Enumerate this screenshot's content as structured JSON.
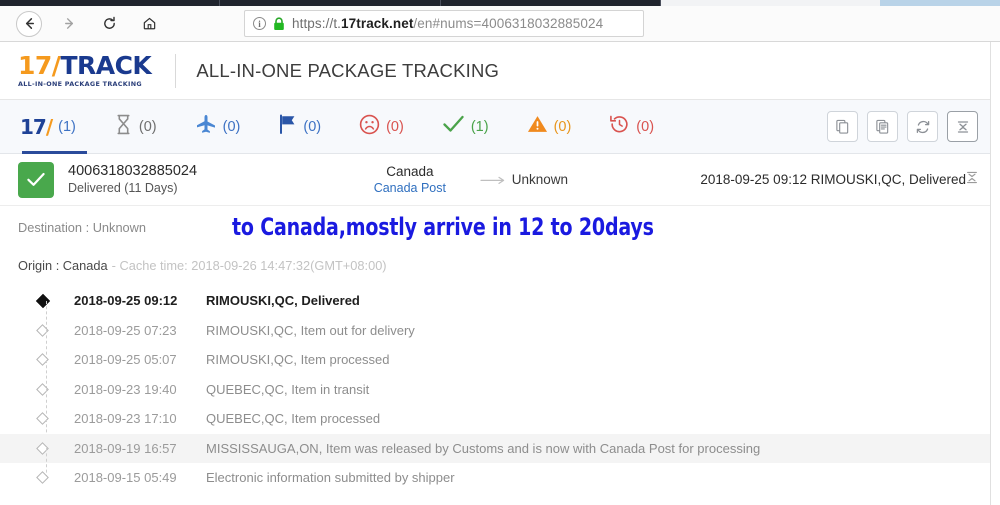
{
  "browser": {
    "back_icon": "back-arrow-icon",
    "forward_icon": "forward-arrow-icon",
    "reload_icon": "reload-icon",
    "home_icon": "home-icon",
    "url_scheme": "https://t.",
    "url_domain": "17track.net",
    "url_path": "/en#nums=4006318032885024",
    "security_icon": "lock-icon",
    "info_icon": "info-icon",
    "info_glyph": "i"
  },
  "brand": {
    "logo_17": "17",
    "logo_slash": "/",
    "logo_track": "TRACK",
    "logo_tagline": "ALL-IN-ONE PACKAGE TRACKING",
    "title": "ALL-IN-ONE PACKAGE TRACKING"
  },
  "tabs": [
    {
      "icon": "17track-logo-icon",
      "label": "17",
      "count": "(1)",
      "active": true
    },
    {
      "icon": "hourglass-icon",
      "label": "",
      "count": "(0)",
      "active": false
    },
    {
      "icon": "airplane-icon",
      "label": "",
      "count": "(0)",
      "active": false
    },
    {
      "icon": "flag-icon",
      "label": "",
      "count": "(0)",
      "active": false
    },
    {
      "icon": "sad-face-icon",
      "label": "",
      "count": "(0)",
      "active": false
    },
    {
      "icon": "check-icon",
      "label": "",
      "count": "(1)",
      "active": false
    },
    {
      "icon": "warning-triangle-icon",
      "label": "",
      "count": "(0)",
      "active": false
    },
    {
      "icon": "clock-rewind-icon",
      "label": "",
      "count": "(0)",
      "active": false
    }
  ],
  "toolbar_buttons": [
    {
      "icon": "copy-icon"
    },
    {
      "icon": "copy-details-icon"
    },
    {
      "icon": "refresh-icon"
    },
    {
      "icon": "collapse-all-icon"
    }
  ],
  "package": {
    "status_icon": "check-icon",
    "status_color": "#49a84c",
    "tracking_number": "4006318032885024",
    "status_text": "Delivered (11 Days)",
    "carrier_country": "Canada",
    "carrier_name": "Canada Post",
    "route_arrow_icon": "arrow-right-icon",
    "destination": "Unknown",
    "latest_event": "2018-09-25 09:12  RIMOUSKI,QC, Delivered",
    "collapse_icon": "collapse-icon"
  },
  "details": {
    "destination_label": "Destination : Unknown",
    "annotation": "to Canada,mostly arrive in 12 to 20days",
    "annotation_color": "#1a1ae0",
    "origin_label": "Origin : Canada",
    "cache_time": "- Cache time: 2018-09-26 14:47:32(GMT+08:00)"
  },
  "events": [
    {
      "time": "2018-09-25 09:12",
      "desc": "RIMOUSKI,QC, Delivered",
      "current": true,
      "highlight": false
    },
    {
      "time": "2018-09-25 07:23",
      "desc": "RIMOUSKI,QC, Item out for delivery",
      "current": false,
      "highlight": false
    },
    {
      "time": "2018-09-25 05:07",
      "desc": "RIMOUSKI,QC, Item processed",
      "current": false,
      "highlight": false
    },
    {
      "time": "2018-09-23 19:40",
      "desc": "QUEBEC,QC, Item in transit",
      "current": false,
      "highlight": false
    },
    {
      "time": "2018-09-23 17:10",
      "desc": "QUEBEC,QC, Item processed",
      "current": false,
      "highlight": false
    },
    {
      "time": "2018-09-19 16:57",
      "desc": "MISSISSAUGA,ON, Item was released by Customs and is now with Canada Post for processing",
      "current": false,
      "highlight": true
    },
    {
      "time": "2018-09-15 05:49",
      "desc": "Electronic information submitted by shipper",
      "current": false,
      "highlight": false
    }
  ]
}
